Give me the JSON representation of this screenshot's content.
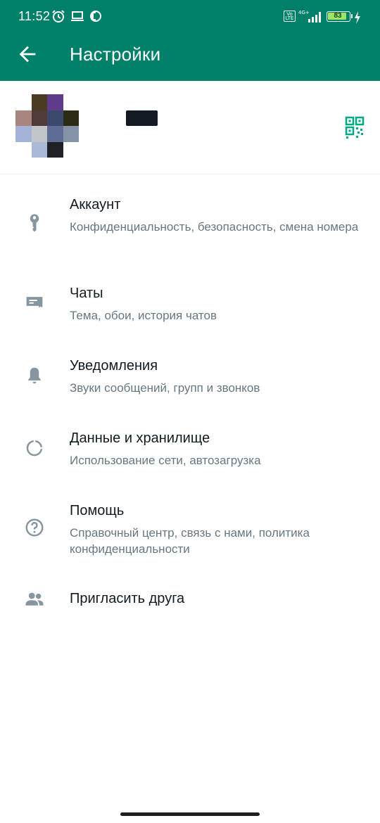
{
  "status_bar": {
    "time": "11:52",
    "network": "4G+",
    "volte": "Vo LTE",
    "battery": "83"
  },
  "app_bar": {
    "title": "Настройки",
    "back_icon": "arrow-back-icon"
  },
  "profile": {
    "avatar": "pixelated-avatar",
    "name": "redacted",
    "qr_icon": "qr-code-icon"
  },
  "menu": [
    {
      "icon": "key-icon",
      "label": "Аккаунт",
      "subtitle": "Конфиденциальность, безопасность, смена номера"
    },
    {
      "icon": "chat-icon",
      "label": "Чаты",
      "subtitle": "Тема, обои, история чатов"
    },
    {
      "icon": "bell-icon",
      "label": "Уведомления",
      "subtitle": "Звуки сообщений, групп и звонков"
    },
    {
      "icon": "data-usage-icon",
      "label": "Данные и хранилище",
      "subtitle": "Использование сети, автозагрузка"
    },
    {
      "icon": "help-icon",
      "label": "Помощь",
      "subtitle": "Справочный центр, связь с нами, политика конфиденциальности"
    },
    {
      "icon": "people-icon",
      "label": "Пригласить друга",
      "subtitle": ""
    }
  ],
  "colors": {
    "header": "#008069",
    "icon": "#8696a0",
    "subtitle": "#667781",
    "accent": "#00a884"
  }
}
